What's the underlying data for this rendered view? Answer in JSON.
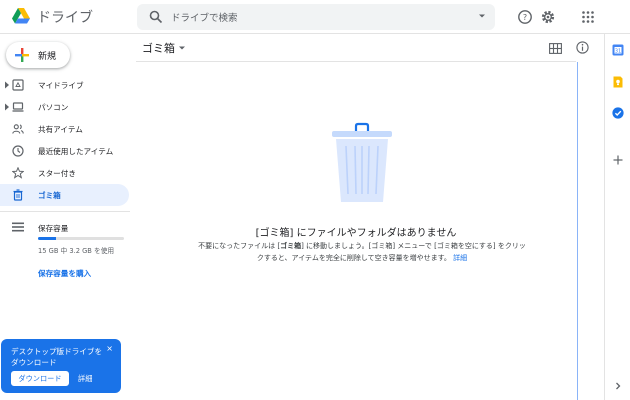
{
  "header": {
    "app_title": "ドライブ",
    "search_placeholder": "ドライブで検索",
    "icons": [
      "drive-logo",
      "search-icon",
      "search-options-icon",
      "help-icon",
      "settings-icon",
      "apps-icon"
    ]
  },
  "sidebar": {
    "new_label": "新規",
    "items": [
      {
        "label": "マイドライブ",
        "icon": "my-drive-icon",
        "expandable": true,
        "active": false
      },
      {
        "label": "パソコン",
        "icon": "computer-icon",
        "expandable": true,
        "active": false
      },
      {
        "label": "共有アイテム",
        "icon": "shared-icon",
        "expandable": false,
        "active": false
      },
      {
        "label": "最近使用したアイテム",
        "icon": "clock-icon",
        "expandable": false,
        "active": false
      },
      {
        "label": "スター付き",
        "icon": "star-icon",
        "expandable": false,
        "active": false
      },
      {
        "label": "ゴミ箱",
        "icon": "trash-icon",
        "expandable": false,
        "active": true
      }
    ],
    "storage": {
      "title": "保存容量",
      "usage_text": "15 GB 中 3.2 GB を使用",
      "used_fraction": 0.21,
      "buy_label": "保存容量を購入"
    }
  },
  "toast": {
    "title": "デスクトップ版ドライブをダウンロード",
    "close": "×",
    "download_label": "ダウンロード",
    "detail_label": "詳細"
  },
  "main": {
    "title": "ゴミ箱",
    "empty_title": "[ゴミ箱] にファイルやフォルダはありません",
    "empty_desc_1": "不要になったファイルは [",
    "empty_desc_bold_1": "ゴミ箱",
    "empty_desc_2": "] に移動しましょう。[ゴミ箱] メニューで [ゴミ箱を空にする] をクリックすると、アイテムを完全に削除して空き容量を増やせます。",
    "empty_desc_link": "詳細"
  },
  "rail": {
    "icons": [
      "calendar-icon",
      "keep-icon",
      "tasks-icon",
      "add-icon",
      "expand-icon"
    ]
  },
  "colors": {
    "accent": "#1a73e8",
    "active_bg": "#e8f0fe"
  }
}
